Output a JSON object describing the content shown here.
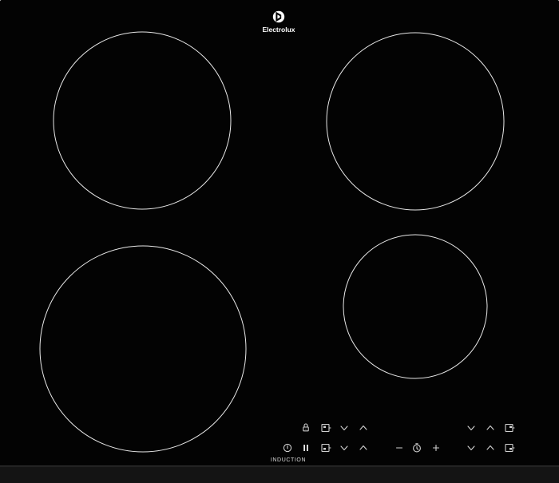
{
  "product": {
    "brand": "Electrolux",
    "label": "INDUCTION"
  },
  "colors": {
    "glass": "#030303",
    "frame": "#1e1e1e",
    "ring": "#e8e8e8",
    "control": "#d0d0d0"
  },
  "cooking_zones": [
    "front-left-zone",
    "rear-left-zone",
    "rear-right-zone",
    "front-right-zone"
  ],
  "controls": {
    "row_top": [
      "lock-icon",
      "zone-select-icon",
      "chevron-down-icon",
      "chevron-up-icon",
      "chevron-down-icon",
      "chevron-up-icon",
      "zone-select-icon"
    ],
    "row_bottom": [
      "power-icon",
      "pause-icon",
      "zone-select-icon",
      "chevron-down-icon",
      "chevron-up-icon",
      "minus-icon",
      "timer-icon",
      "plus-icon",
      "chevron-down-icon",
      "chevron-up-icon",
      "zone-select-icon"
    ]
  }
}
